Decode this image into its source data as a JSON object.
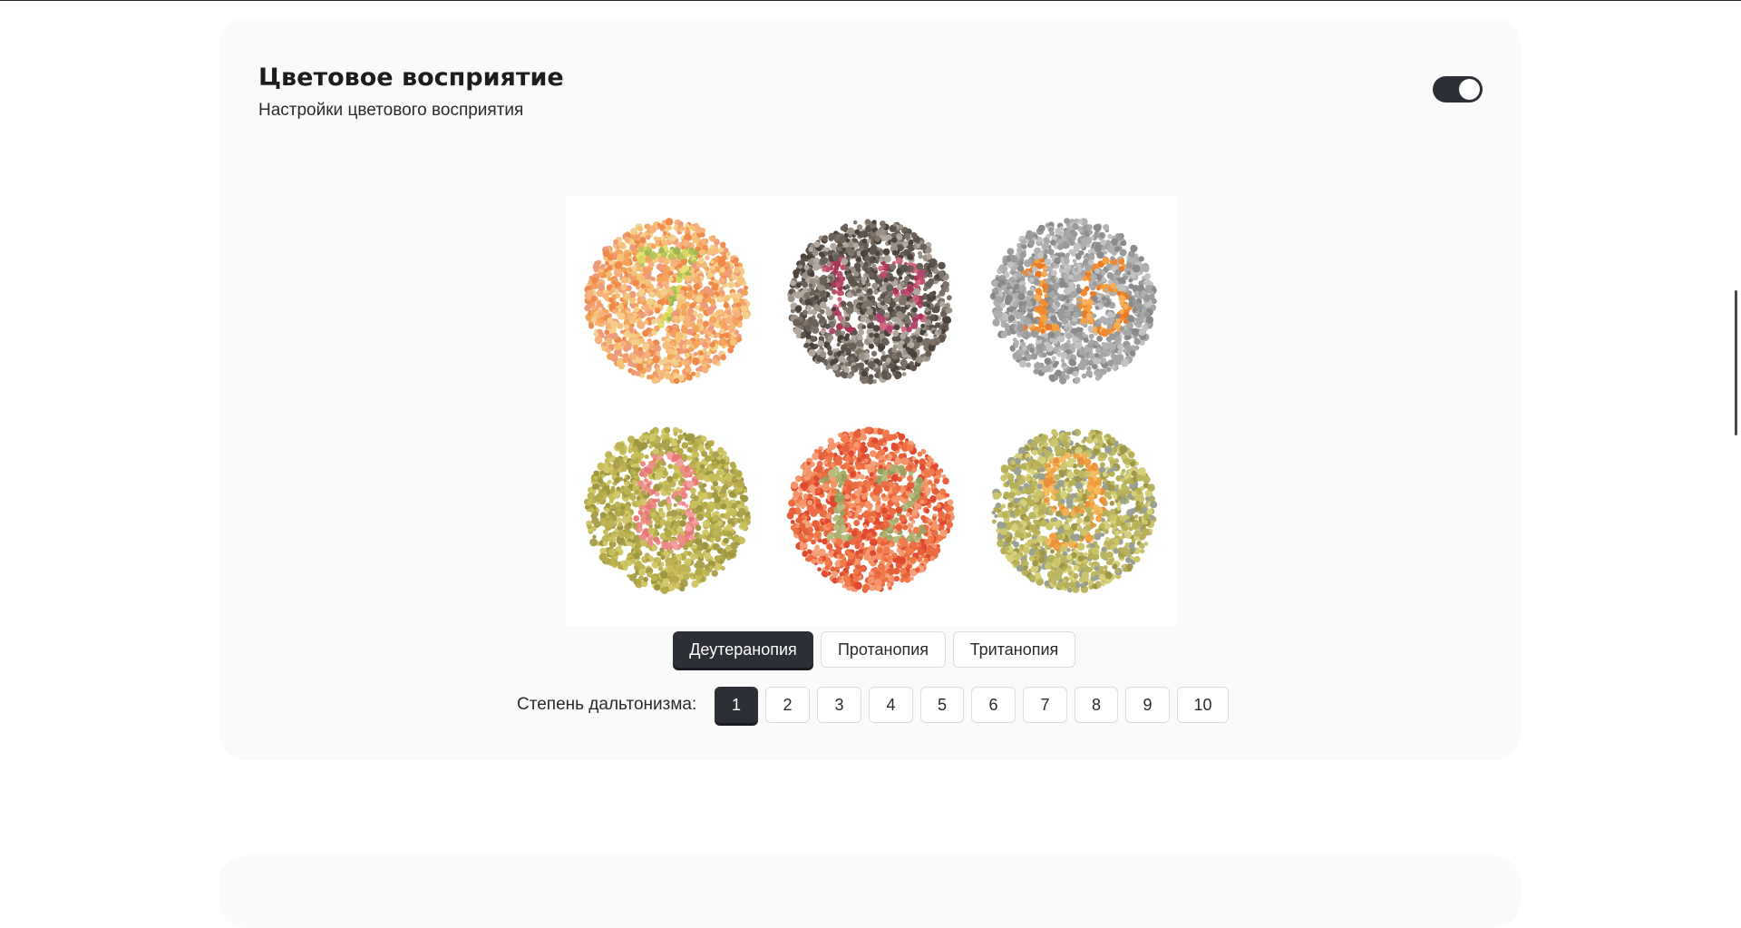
{
  "section": {
    "title": "Цветовое восприятие",
    "subtitle": "Настройки цветового восприятия",
    "enabled": true
  },
  "plates": [
    {
      "number": "7",
      "colors": {
        "background": [
          "#f3a45a",
          "#f6c27a",
          "#f08a4a",
          "#f7b27c",
          "#f4d08c",
          "#ef9a7a"
        ],
        "figure": [
          "#b8c45a",
          "#d8d860",
          "#9fb852",
          "#e6e070"
        ]
      }
    },
    {
      "number": "13",
      "colors": {
        "background": [
          "#5c544c",
          "#7c7268",
          "#9a9086",
          "#4a423c",
          "#b0a89e",
          "#6a6058"
        ],
        "figure": [
          "#c0506a",
          "#a83858",
          "#d06a80",
          "#b04870"
        ]
      }
    },
    {
      "number": "16",
      "colors": {
        "background": [
          "#9a9a9a",
          "#b0b0b0",
          "#8a8a8a",
          "#a6a6a6",
          "#c2c2c2"
        ],
        "figure": [
          "#f08a30",
          "#f4a040",
          "#e87a28",
          "#f6ae58"
        ]
      }
    },
    {
      "number": "8",
      "colors": {
        "background": [
          "#b4aa48",
          "#c8be5a",
          "#9e9640",
          "#d2c86a",
          "#aaa04e",
          "#beb456"
        ],
        "figure": [
          "#f08a8a",
          "#e87878",
          "#f4a0a0",
          "#ea9080"
        ]
      }
    },
    {
      "number": "12",
      "colors": {
        "background": [
          "#e8603a",
          "#f07a4a",
          "#f49468",
          "#e04a30",
          "#f6a07a",
          "#ec6c44"
        ],
        "figure": [
          "#aab070",
          "#98a060",
          "#b8bc80",
          "#a6a86a"
        ]
      }
    },
    {
      "number": "9",
      "colors": {
        "background": [
          "#b8b058",
          "#ccc46a",
          "#a09848",
          "#d6d07a",
          "#9aa094",
          "#bcb660"
        ],
        "figure": [
          "#f0a040",
          "#f4b050",
          "#e8903a",
          "#f6bc60"
        ]
      }
    }
  ],
  "modes": {
    "active": "Деутеранопия",
    "items": [
      "Деутеранопия",
      "Протанопия",
      "Тританопия"
    ]
  },
  "degree": {
    "label": "Степень дальтонизма:",
    "active": "1",
    "items": [
      "1",
      "2",
      "3",
      "4",
      "5",
      "6",
      "7",
      "8",
      "9",
      "10"
    ]
  },
  "colors": {
    "card_bg": "#fafafa",
    "accent_dark": "#2d2f36",
    "button_border": "#dadce0"
  }
}
